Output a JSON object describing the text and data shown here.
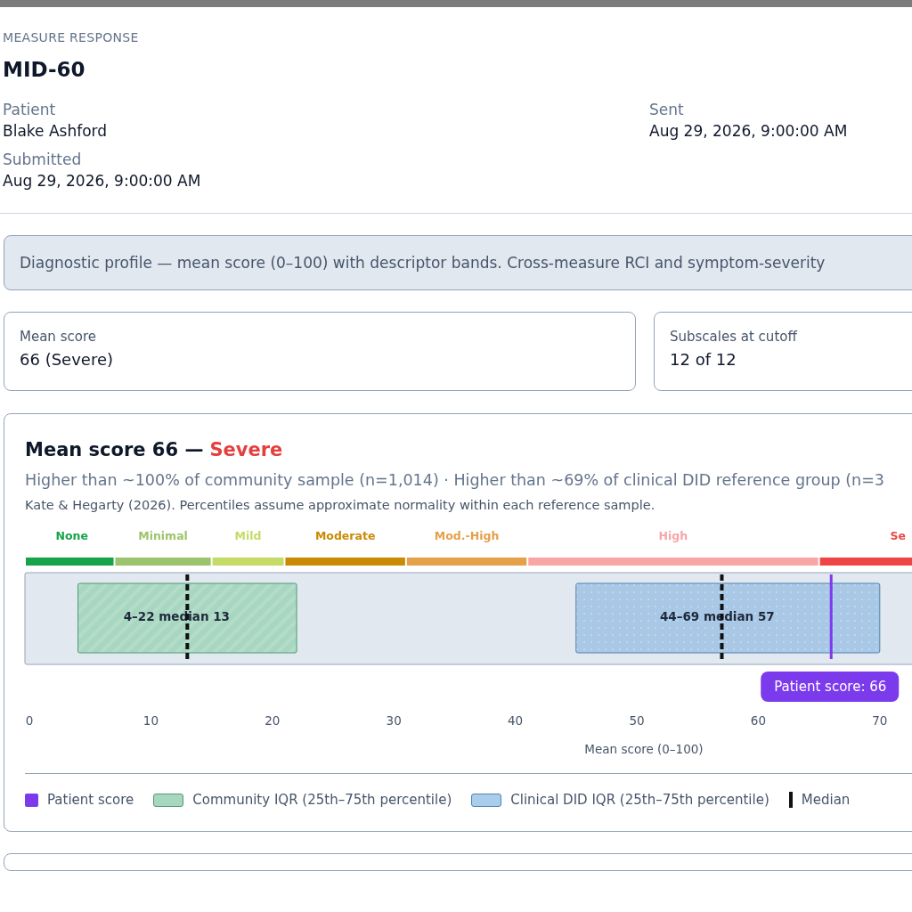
{
  "header": {
    "eyebrow": "MEASURE RESPONSE",
    "title": "MID-60"
  },
  "fields": [
    {
      "label": "Patient",
      "value": "Blake Ashford"
    },
    {
      "label": "Sent",
      "value": "Aug 29, 2026, 9:00:00 AM"
    },
    {
      "label": "Submitted",
      "value": "Aug 29, 2026, 9:00:00 AM"
    }
  ],
  "notice": "Diagnostic profile — mean score (0–100) with descriptor bands. Cross-measure RCI and symptom-severity",
  "stats": [
    {
      "label": "Mean score",
      "value": "66 (Severe)"
    },
    {
      "label": "Subscales at cutoff",
      "value": "12 of 12"
    }
  ],
  "profile": {
    "title": "Mean score 66 —",
    "severity": "Severe",
    "summary": "Higher than ~100% of community sample (n=1,014) · Higher than ~69% of clinical DID reference group (n=3",
    "source": "Kate & Hegarty (2026). Percentiles assume approximate normality within each reference sample.",
    "bands": [
      {
        "label": "None",
        "color": "#16a34a"
      },
      {
        "label": "Minimal",
        "color": "#9cc46c"
      },
      {
        "label": "Mild",
        "color": "#c4db68"
      },
      {
        "label": "Moderate",
        "color": "#ca8a04"
      },
      {
        "label": "Mod.-High",
        "color": "#e5a04a"
      },
      {
        "label": "High",
        "color": "#f8a5a5"
      },
      {
        "label": "Se",
        "color": "#ef4444"
      }
    ],
    "ranges": [
      {
        "kind": "community",
        "label": "4–22 median 13"
      },
      {
        "kind": "clinical",
        "label": "44–69 median 57"
      }
    ],
    "patient_badge": "Patient score: 66",
    "axis": {
      "ticks": [
        "0",
        "10",
        "20",
        "30",
        "40",
        "50",
        "60",
        "70"
      ],
      "title": "Mean score (0–100)"
    },
    "legend": [
      {
        "kind": "patient",
        "label": "Patient score"
      },
      {
        "kind": "community",
        "label": "Community IQR (25th–75th percentile)"
      },
      {
        "kind": "clinical",
        "label": "Clinical DID IQR (25th–75th percentile)"
      },
      {
        "kind": "median",
        "label": "Median"
      }
    ]
  }
}
